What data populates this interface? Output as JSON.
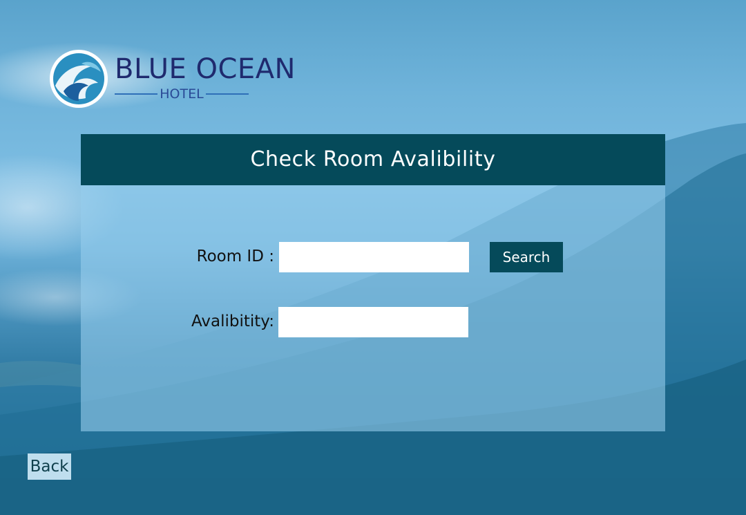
{
  "brand": {
    "name": "BLUE OCEAN",
    "sub": "HOTEL"
  },
  "panel": {
    "title": "Check Room Avalibility",
    "room_id_label": "Room ID :",
    "room_id_value": "",
    "availability_label": "Avalibitity:",
    "availability_value": "",
    "search_label": "Search"
  },
  "back_label": "Back",
  "colors": {
    "header_bg": "#054a5a",
    "brand_text": "#1f2a6e",
    "panel_bg": "#96cdec"
  }
}
